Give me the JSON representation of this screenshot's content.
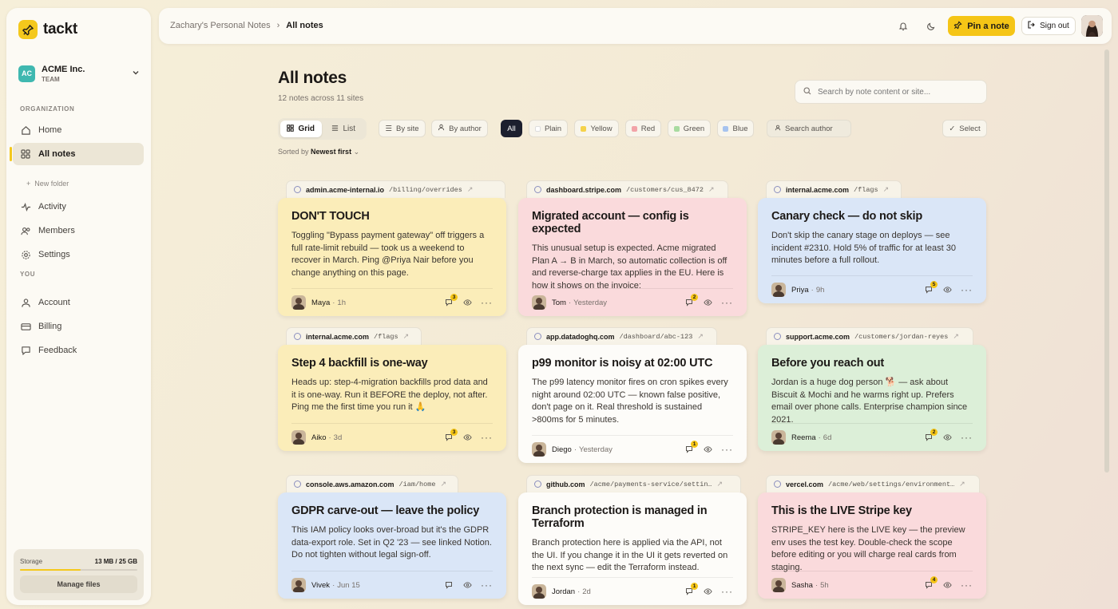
{
  "app": {
    "name": "tackt"
  },
  "org": {
    "initials": "AC",
    "name": "ACME Inc.",
    "role": "TEAM"
  },
  "sidebar": {
    "section_org": "ORGANIZATION",
    "section_you": "YOU",
    "items": [
      {
        "label": "Home",
        "icon": "home-icon"
      },
      {
        "label": "All notes",
        "icon": "grid-icon"
      },
      {
        "label": "Activity",
        "icon": "activity-icon"
      },
      {
        "label": "Members",
        "icon": "members-icon"
      },
      {
        "label": "Settings",
        "icon": "gear-icon"
      },
      {
        "label": "Account",
        "icon": "user-icon"
      },
      {
        "label": "Billing",
        "icon": "card-icon"
      },
      {
        "label": "Feedback",
        "icon": "chat-icon"
      }
    ],
    "new_folder": "New folder",
    "storage": {
      "label": "Storage",
      "value": "13 MB / 25 GB",
      "manage": "Manage files"
    }
  },
  "topbar": {
    "breadcrumb_root": "Zachary's Personal Notes",
    "breadcrumb_sep": "›",
    "breadcrumb_current": "All notes",
    "pin_label": "Pin a note",
    "signout_label": "Sign out"
  },
  "main": {
    "title": "All notes",
    "subtitle": "12 notes across 11 sites",
    "search_placeholder": "Search by note content or site...",
    "view": {
      "grid": "Grid",
      "list": "List"
    },
    "group": {
      "by_site": "By site",
      "by_author": "By author"
    },
    "filters": [
      {
        "label": "All",
        "color": ""
      },
      {
        "label": "Plain",
        "color": "#ffffff"
      },
      {
        "label": "Yellow",
        "color": "#f5d24a"
      },
      {
        "label": "Red",
        "color": "#f2a3a8"
      },
      {
        "label": "Green",
        "color": "#a8dba0"
      },
      {
        "label": "Blue",
        "color": "#a6c3ef"
      }
    ],
    "search_author": "Search author",
    "select": "Select",
    "sort_prefix": "Sorted by",
    "sort_value": "Newest first"
  },
  "notes": [
    {
      "domain": "admin.acme-internal.io",
      "path": "/billing/overrides",
      "color": "yellow",
      "title": "DON'T TOUCH",
      "body": "Toggling \"Bypass payment gateway\" off triggers a full rate-limit rebuild — took us a weekend to recover in March. Ping @Priya Nair before you change anything on this page.",
      "author": "Maya",
      "time": "1h",
      "comments": "3"
    },
    {
      "domain": "dashboard.stripe.com",
      "path": "/customers/cus_8472",
      "color": "red",
      "title": "Migrated account — config is expected",
      "body": "This unusual setup is expected. Acme migrated Plan A → B in March, so automatic collection is off and reverse-charge tax applies in the EU. Here is how it shows on the invoice:",
      "author": "Tom",
      "time": "Yesterday",
      "comments": "2"
    },
    {
      "domain": "internal.acme.com",
      "path": "/flags",
      "color": "blue",
      "title": "Canary check — do not skip",
      "body": "Don't skip the canary stage on deploys — see incident #2310. Hold 5% of traffic for at least 30 minutes before a full rollout.",
      "author": "Priya",
      "time": "9h",
      "comments": "5"
    },
    {
      "domain": "internal.acme.com",
      "path": "/flags",
      "color": "yellow",
      "title": "Step 4 backfill is one-way",
      "body": "Heads up: step-4-migration backfills prod data and it is one-way. Run it BEFORE the deploy, not after. Ping me the first time you run it 🙏",
      "author": "Aiko",
      "time": "3d",
      "comments": "3"
    },
    {
      "domain": "app.datadoghq.com",
      "path": "/dashboard/abc-123",
      "color": "plain",
      "title": "p99 monitor is noisy at 02:00 UTC",
      "body": "The p99 latency monitor fires on cron spikes every night around 02:00 UTC — known false positive, don't page on it. Real threshold is sustained >800ms for 5 minutes.",
      "author": "Diego",
      "time": "Yesterday",
      "comments": "1"
    },
    {
      "domain": "support.acme.com",
      "path": "/customers/jordan-reyes",
      "color": "green",
      "title": "Before you reach out",
      "body": "Jordan is a huge dog person 🐕 — ask about Biscuit & Mochi and he warms right up. Prefers email over phone calls. Enterprise champion since 2021.",
      "author": "Reema",
      "time": "6d",
      "comments": "2"
    },
    {
      "domain": "console.aws.amazon.com",
      "path": "/iam/home",
      "color": "blue",
      "title": "GDPR carve-out — leave the policy",
      "body": "This IAM policy looks over-broad but it's the GDPR data-export role. Set in Q2 '23 — see linked Notion. Do not tighten without legal sign-off.",
      "author": "Vivek",
      "time": "Jun 15",
      "comments": ""
    },
    {
      "domain": "github.com",
      "path": "/acme/payments-service/settin…",
      "color": "plain",
      "title": "Branch protection is managed in Terraform",
      "body": "Branch protection here is applied via the API, not the UI. If you change it in the UI it gets reverted on the next sync — edit the Terraform instead.",
      "author": "Jordan",
      "time": "2d",
      "comments": "1"
    },
    {
      "domain": "vercel.com",
      "path": "/acme/web/settings/environment…",
      "color": "red",
      "title": "This is the LIVE Stripe key",
      "body": "STRIPE_KEY here is the LIVE key — the preview env uses the test key. Double-check the scope before editing or you will charge real cards from staging.",
      "author": "Sasha",
      "time": "5h",
      "comments": "4"
    }
  ]
}
